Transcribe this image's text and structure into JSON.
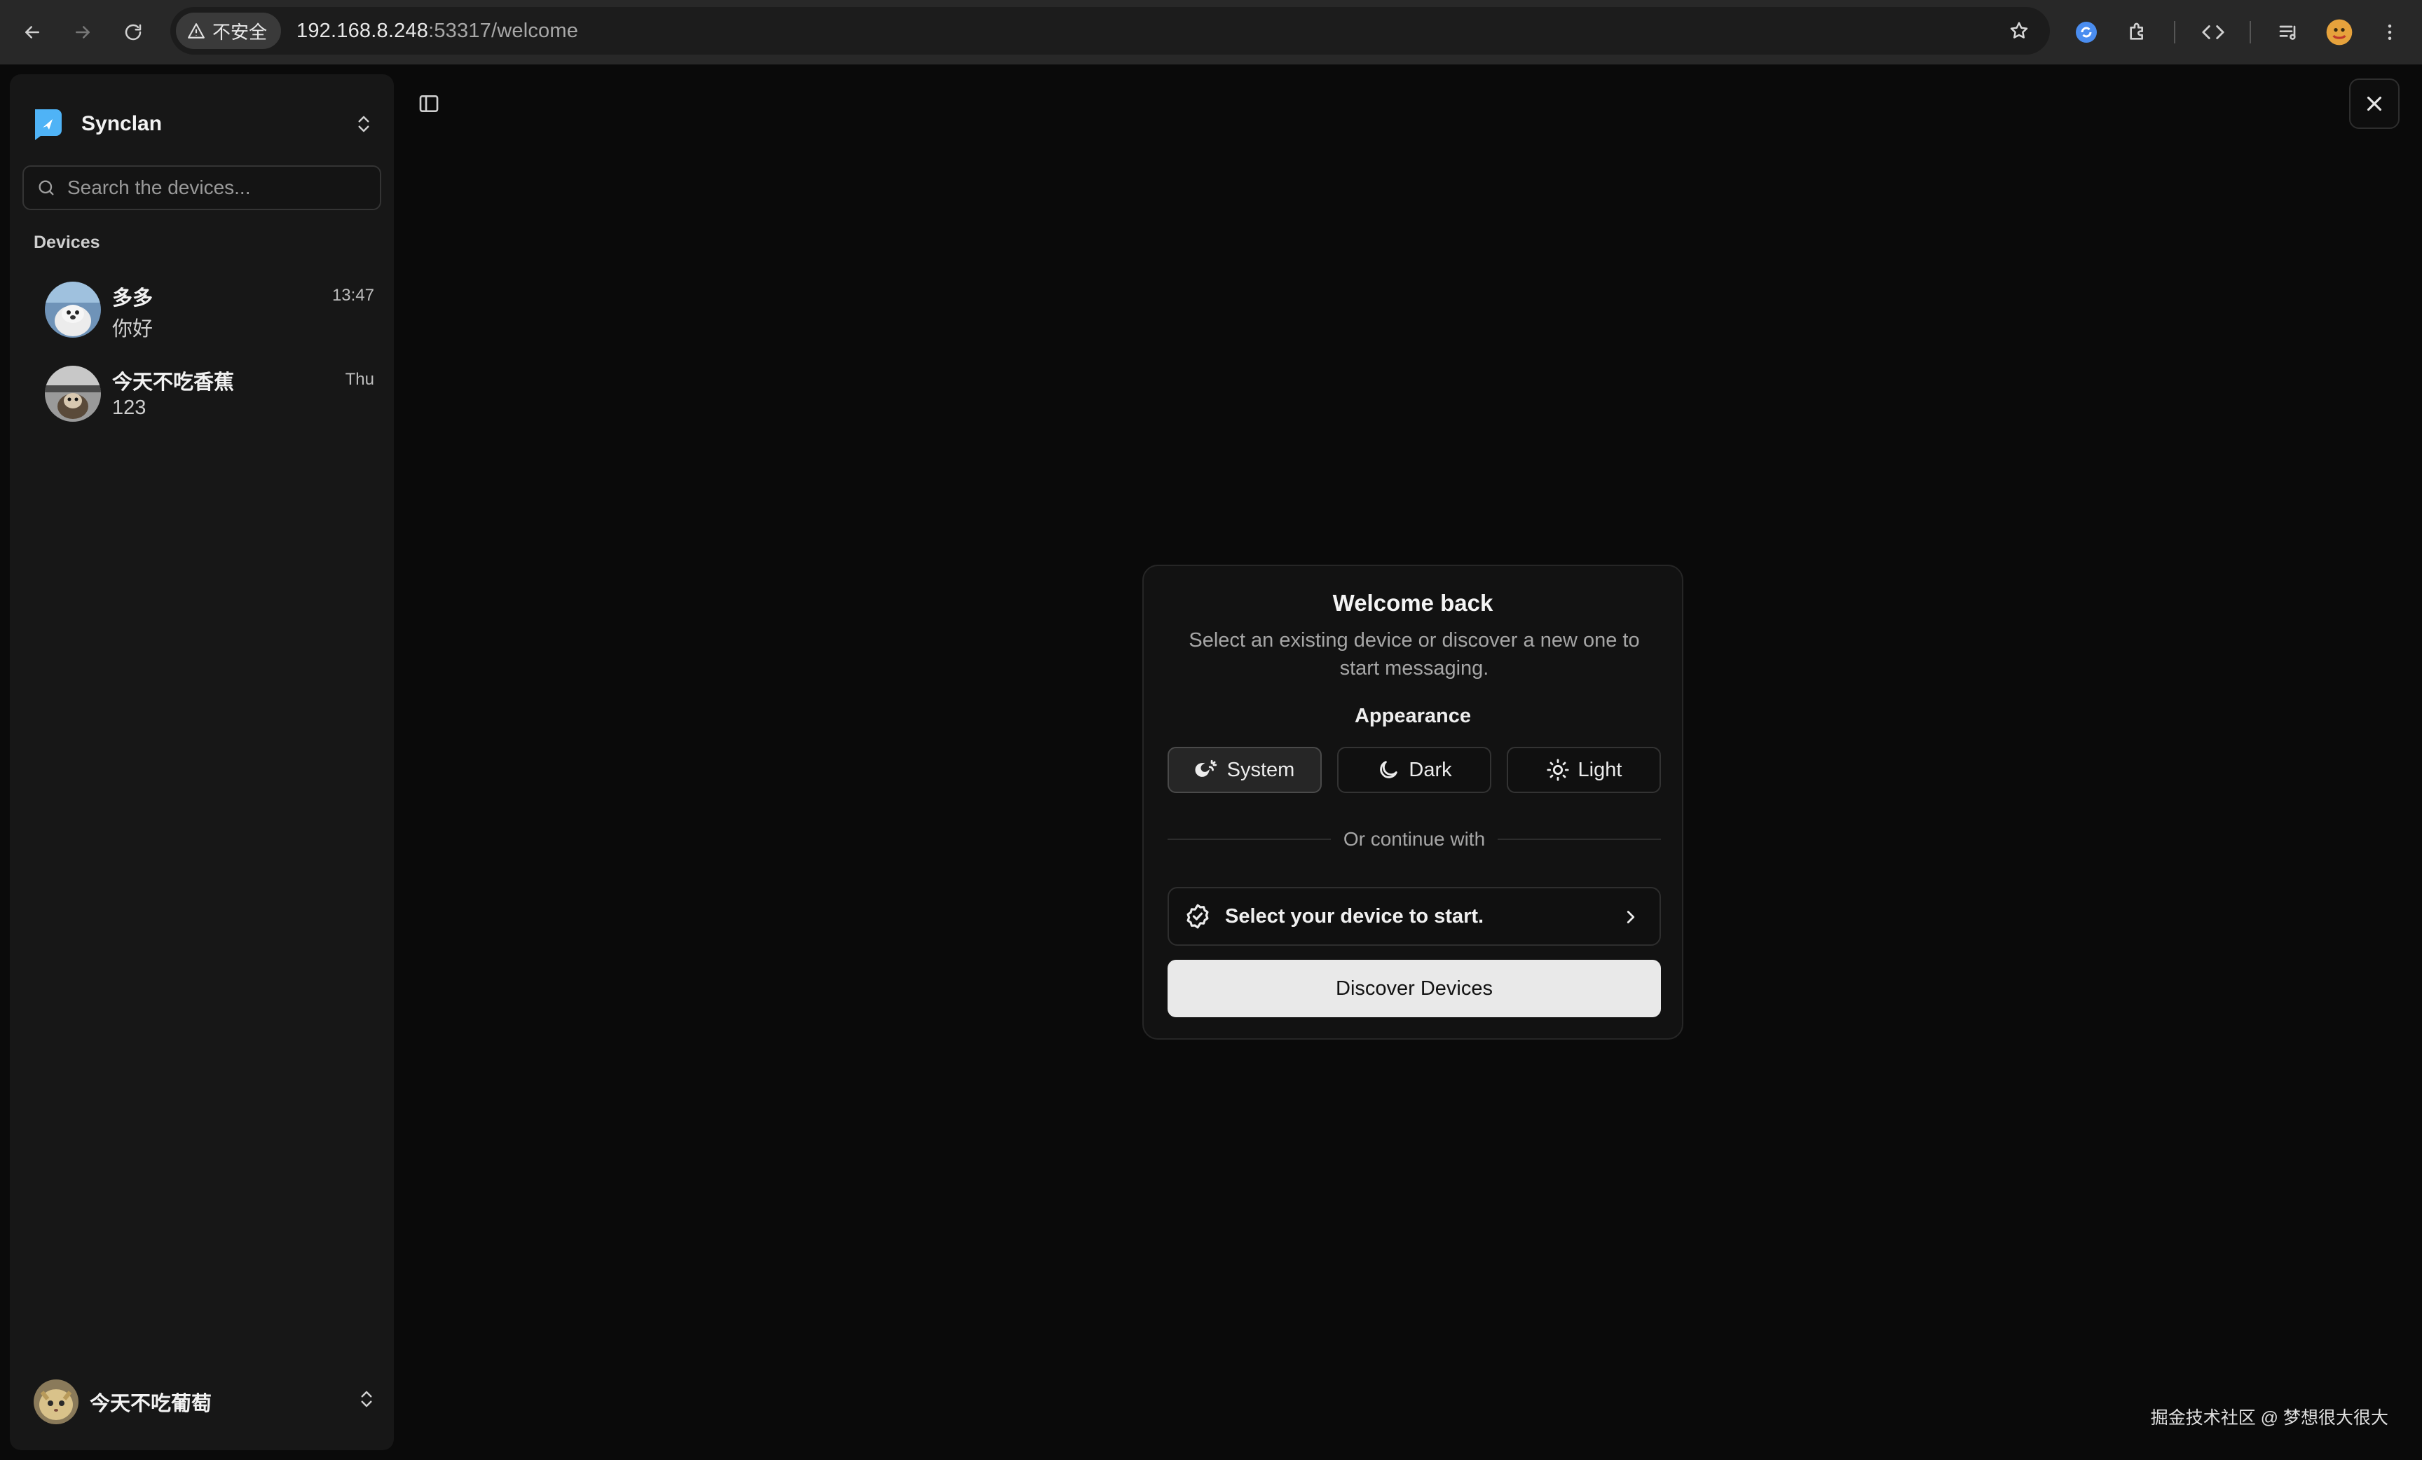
{
  "browser": {
    "security_label": "不安全",
    "url_host": "192.168.8.248",
    "url_rest": ":53317/welcome"
  },
  "sidebar": {
    "app_name": "Synclan",
    "search_placeholder": "Search the devices...",
    "section_label": "Devices",
    "devices": [
      {
        "name": "多多",
        "message": "你好",
        "time": "13:47"
      },
      {
        "name": "今天不吃香蕉",
        "message": "123",
        "time": "Thu"
      }
    ],
    "current_user": "今天不吃葡萄"
  },
  "welcome": {
    "title": "Welcome back",
    "subtitle": "Select an existing device or discover a new one to start messaging.",
    "appearance_label": "Appearance",
    "themes": [
      "System",
      "Dark",
      "Light"
    ],
    "selected_theme": "System",
    "divider_text": "Or continue with",
    "select_device_label": "Select your device to start.",
    "discover_label": "Discover Devices"
  },
  "watermark": "掘金技术社区 @ 梦想很大很大",
  "colors": {
    "background": "#0a0a0a",
    "sidebar": "#171717",
    "card": "#121212",
    "accent_logo": "#4fb3f6",
    "primary_button": "#e9e9e9"
  }
}
